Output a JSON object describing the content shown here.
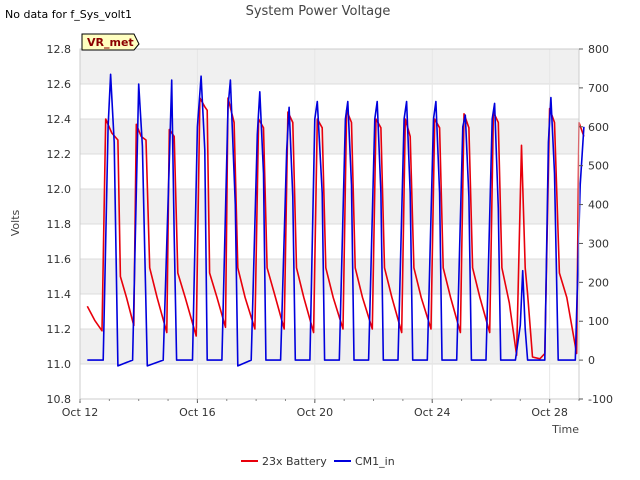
{
  "header": {
    "title": "System Power Voltage",
    "no_data_note": "No data for f_Sys_volt1",
    "badge": "VR_met"
  },
  "colors": {
    "battery": "#e8000b",
    "cm1": "#0000dd",
    "band": "#f0f0f0",
    "badge_fill": "#ffffc0",
    "badge_border": "#000000"
  },
  "chart_data": {
    "type": "line",
    "title": "System Power Voltage",
    "xlabel": "Time",
    "ylabel": "Volts",
    "ylim": [
      10.8,
      12.8
    ],
    "y2lim": [
      -100,
      800
    ],
    "xlim": [
      "2023-10-12",
      "2023-10-29"
    ],
    "x_ticks": [
      "Oct 12",
      "Oct 16",
      "Oct 20",
      "Oct 24",
      "Oct 28"
    ],
    "x_tick_dates": [
      "2023-10-12",
      "2023-10-16",
      "2023-10-20",
      "2023-10-24",
      "2023-10-28"
    ],
    "y_ticks": [
      "10.8",
      "11.0",
      "11.2",
      "11.4",
      "11.6",
      "11.8",
      "12.0",
      "12.2",
      "12.4",
      "12.6",
      "12.8"
    ],
    "y2_ticks": [
      "-100",
      "0",
      "100",
      "200",
      "300",
      "400",
      "500",
      "600",
      "700",
      "800"
    ],
    "grid": true,
    "legend_position": "bottom",
    "series": [
      {
        "name": "23x Battery",
        "axis": "left",
        "points": [
          [
            "2023-10-12 06:00",
            11.33
          ],
          [
            "2023-10-12 12:00",
            11.25
          ],
          [
            "2023-10-12 18:00",
            11.19
          ],
          [
            "2023-10-12 21:00",
            12.4
          ],
          [
            "2023-10-13 02:00",
            12.32
          ],
          [
            "2023-10-13 07:00",
            12.28
          ],
          [
            "2023-10-13 09:00",
            11.5
          ],
          [
            "2023-10-13 14:00",
            11.38
          ],
          [
            "2023-10-13 20:00",
            11.22
          ],
          [
            "2023-10-13 22:00",
            12.37
          ],
          [
            "2023-10-14 02:00",
            12.3
          ],
          [
            "2023-10-14 06:00",
            12.28
          ],
          [
            "2023-10-14 09:00",
            11.55
          ],
          [
            "2023-10-14 15:00",
            11.38
          ],
          [
            "2023-10-14 23:00",
            11.18
          ],
          [
            "2023-10-15 01:00",
            12.34
          ],
          [
            "2023-10-15 05:00",
            12.3
          ],
          [
            "2023-10-15 08:00",
            11.52
          ],
          [
            "2023-10-15 14:00",
            11.38
          ],
          [
            "2023-10-15 23:00",
            11.16
          ],
          [
            "2023-10-16 02:00",
            12.52
          ],
          [
            "2023-10-16 06:00",
            12.47
          ],
          [
            "2023-10-16 08:00",
            12.45
          ],
          [
            "2023-10-16 10:00",
            11.52
          ],
          [
            "2023-10-16 16:00",
            11.38
          ],
          [
            "2023-10-16 23:00",
            11.21
          ],
          [
            "2023-10-17 01:00",
            12.52
          ],
          [
            "2023-10-17 06:00",
            12.38
          ],
          [
            "2023-10-17 09:00",
            11.55
          ],
          [
            "2023-10-17 15:00",
            11.38
          ],
          [
            "2023-10-17 23:00",
            11.2
          ],
          [
            "2023-10-18 02:00",
            12.4
          ],
          [
            "2023-10-18 06:00",
            12.35
          ],
          [
            "2023-10-18 09:00",
            11.55
          ],
          [
            "2023-10-18 15:00",
            11.4
          ],
          [
            "2023-10-18 23:00",
            11.2
          ],
          [
            "2023-10-19 02:00",
            12.44
          ],
          [
            "2023-10-19 06:00",
            12.38
          ],
          [
            "2023-10-19 09:00",
            11.55
          ],
          [
            "2023-10-19 15:00",
            11.38
          ],
          [
            "2023-10-19 23:00",
            11.18
          ],
          [
            "2023-10-20 02:00",
            12.4
          ],
          [
            "2023-10-20 06:00",
            12.35
          ],
          [
            "2023-10-20 09:00",
            11.55
          ],
          [
            "2023-10-20 15:00",
            11.38
          ],
          [
            "2023-10-20 23:00",
            11.2
          ],
          [
            "2023-10-21 02:00",
            12.45
          ],
          [
            "2023-10-21 06:00",
            12.38
          ],
          [
            "2023-10-21 09:00",
            11.55
          ],
          [
            "2023-10-21 15:00",
            11.38
          ],
          [
            "2023-10-21 23:00",
            11.2
          ],
          [
            "2023-10-22 02:00",
            12.4
          ],
          [
            "2023-10-22 06:00",
            12.35
          ],
          [
            "2023-10-22 09:00",
            11.55
          ],
          [
            "2023-10-22 15:00",
            11.38
          ],
          [
            "2023-10-22 23:00",
            11.18
          ],
          [
            "2023-10-23 02:00",
            12.4
          ],
          [
            "2023-10-23 06:00",
            12.3
          ],
          [
            "2023-10-23 09:00",
            11.55
          ],
          [
            "2023-10-23 15:00",
            11.38
          ],
          [
            "2023-10-23 23:00",
            11.2
          ],
          [
            "2023-10-24 02:00",
            12.4
          ],
          [
            "2023-10-24 06:00",
            12.35
          ],
          [
            "2023-10-24 09:00",
            11.55
          ],
          [
            "2023-10-24 15:00",
            11.38
          ],
          [
            "2023-10-24 23:00",
            11.18
          ],
          [
            "2023-10-25 02:00",
            12.43
          ],
          [
            "2023-10-25 06:00",
            12.35
          ],
          [
            "2023-10-25 09:00",
            11.55
          ],
          [
            "2023-10-25 15:00",
            11.38
          ],
          [
            "2023-10-25 23:00",
            11.18
          ],
          [
            "2023-10-26 02:00",
            12.44
          ],
          [
            "2023-10-26 06:00",
            12.38
          ],
          [
            "2023-10-26 09:00",
            11.55
          ],
          [
            "2023-10-26 15:00",
            11.35
          ],
          [
            "2023-10-26 21:00",
            11.05
          ],
          [
            "2023-10-27 01:00",
            12.25
          ],
          [
            "2023-10-27 04:00",
            11.55
          ],
          [
            "2023-10-27 06:00",
            11.4
          ],
          [
            "2023-10-27 10:00",
            11.04
          ],
          [
            "2023-10-27 16:00",
            11.03
          ],
          [
            "2023-10-27 20:00",
            11.06
          ],
          [
            "2023-10-28 00:00",
            12.46
          ],
          [
            "2023-10-28 04:00",
            12.38
          ],
          [
            "2023-10-28 08:00",
            11.52
          ],
          [
            "2023-10-28 14:00",
            11.38
          ],
          [
            "2023-10-28 22:00",
            11.06
          ],
          [
            "2023-10-29 00:00",
            12.38
          ],
          [
            "2023-10-29 04:00",
            12.3
          ]
        ]
      },
      {
        "name": "CM1_in",
        "axis": "right",
        "points": [
          [
            "2023-10-12 06:00",
            0
          ],
          [
            "2023-10-12 19:00",
            0
          ],
          [
            "2023-10-12 23:00",
            600
          ],
          [
            "2023-10-13 01:00",
            735
          ],
          [
            "2023-10-13 04:00",
            560
          ],
          [
            "2023-10-13 07:00",
            -15
          ],
          [
            "2023-10-13 19:00",
            0
          ],
          [
            "2023-10-14 00:00",
            710
          ],
          [
            "2023-10-14 03:00",
            550
          ],
          [
            "2023-10-14 07:00",
            -15
          ],
          [
            "2023-10-14 20:00",
            0
          ],
          [
            "2023-10-15 01:00",
            510
          ],
          [
            "2023-10-15 03:00",
            720
          ],
          [
            "2023-10-15 05:00",
            320
          ],
          [
            "2023-10-15 07:00",
            0
          ],
          [
            "2023-10-15 20:00",
            0
          ],
          [
            "2023-10-16 00:00",
            600
          ],
          [
            "2023-10-16 03:00",
            730
          ],
          [
            "2023-10-16 06:00",
            540
          ],
          [
            "2023-10-16 08:00",
            0
          ],
          [
            "2023-10-16 20:00",
            0
          ],
          [
            "2023-10-17 01:00",
            650
          ],
          [
            "2023-10-17 03:00",
            720
          ],
          [
            "2023-10-17 07:00",
            400
          ],
          [
            "2023-10-17 09:00",
            -15
          ],
          [
            "2023-10-17 20:00",
            0
          ],
          [
            "2023-10-18 01:00",
            580
          ],
          [
            "2023-10-18 03:00",
            690
          ],
          [
            "2023-10-18 06:00",
            480
          ],
          [
            "2023-10-18 08:00",
            0
          ],
          [
            "2023-10-18 20:00",
            0
          ],
          [
            "2023-10-19 01:00",
            540
          ],
          [
            "2023-10-19 03:00",
            650
          ],
          [
            "2023-10-19 06:00",
            420
          ],
          [
            "2023-10-19 08:00",
            0
          ],
          [
            "2023-10-19 20:00",
            0
          ],
          [
            "2023-10-20 00:00",
            620
          ],
          [
            "2023-10-20 02:00",
            665
          ],
          [
            "2023-10-20 06:00",
            430
          ],
          [
            "2023-10-20 08:00",
            0
          ],
          [
            "2023-10-20 20:00",
            0
          ],
          [
            "2023-10-21 01:00",
            620
          ],
          [
            "2023-10-21 03:00",
            665
          ],
          [
            "2023-10-21 06:00",
            450
          ],
          [
            "2023-10-21 08:00",
            0
          ],
          [
            "2023-10-21 20:00",
            0
          ],
          [
            "2023-10-22 01:00",
            620
          ],
          [
            "2023-10-22 03:00",
            665
          ],
          [
            "2023-10-22 06:00",
            430
          ],
          [
            "2023-10-22 08:00",
            0
          ],
          [
            "2023-10-22 20:00",
            0
          ],
          [
            "2023-10-23 01:00",
            620
          ],
          [
            "2023-10-23 03:00",
            665
          ],
          [
            "2023-10-23 06:00",
            430
          ],
          [
            "2023-10-23 08:00",
            0
          ],
          [
            "2023-10-23 20:00",
            0
          ],
          [
            "2023-10-24 01:00",
            620
          ],
          [
            "2023-10-24 03:00",
            665
          ],
          [
            "2023-10-24 06:00",
            430
          ],
          [
            "2023-10-24 08:00",
            0
          ],
          [
            "2023-10-24 20:00",
            0
          ],
          [
            "2023-10-25 01:00",
            600
          ],
          [
            "2023-10-25 03:00",
            630
          ],
          [
            "2023-10-25 06:00",
            420
          ],
          [
            "2023-10-25 08:00",
            0
          ],
          [
            "2023-10-25 20:00",
            0
          ],
          [
            "2023-10-26 01:00",
            620
          ],
          [
            "2023-10-26 03:00",
            660
          ],
          [
            "2023-10-26 06:00",
            390
          ],
          [
            "2023-10-26 08:00",
            0
          ],
          [
            "2023-10-26 20:00",
            0
          ],
          [
            "2023-10-27 00:00",
            90
          ],
          [
            "2023-10-27 02:00",
            230
          ],
          [
            "2023-10-27 04:00",
            80
          ],
          [
            "2023-10-27 06:00",
            0
          ],
          [
            "2023-10-27 20:00",
            0
          ],
          [
            "2023-10-27 23:00",
            560
          ],
          [
            "2023-10-28 01:00",
            675
          ],
          [
            "2023-10-28 04:00",
            480
          ],
          [
            "2023-10-28 07:00",
            0
          ],
          [
            "2023-10-28 21:00",
            0
          ],
          [
            "2023-10-29 01:00",
            450
          ],
          [
            "2023-10-29 04:00",
            600
          ]
        ]
      }
    ]
  }
}
